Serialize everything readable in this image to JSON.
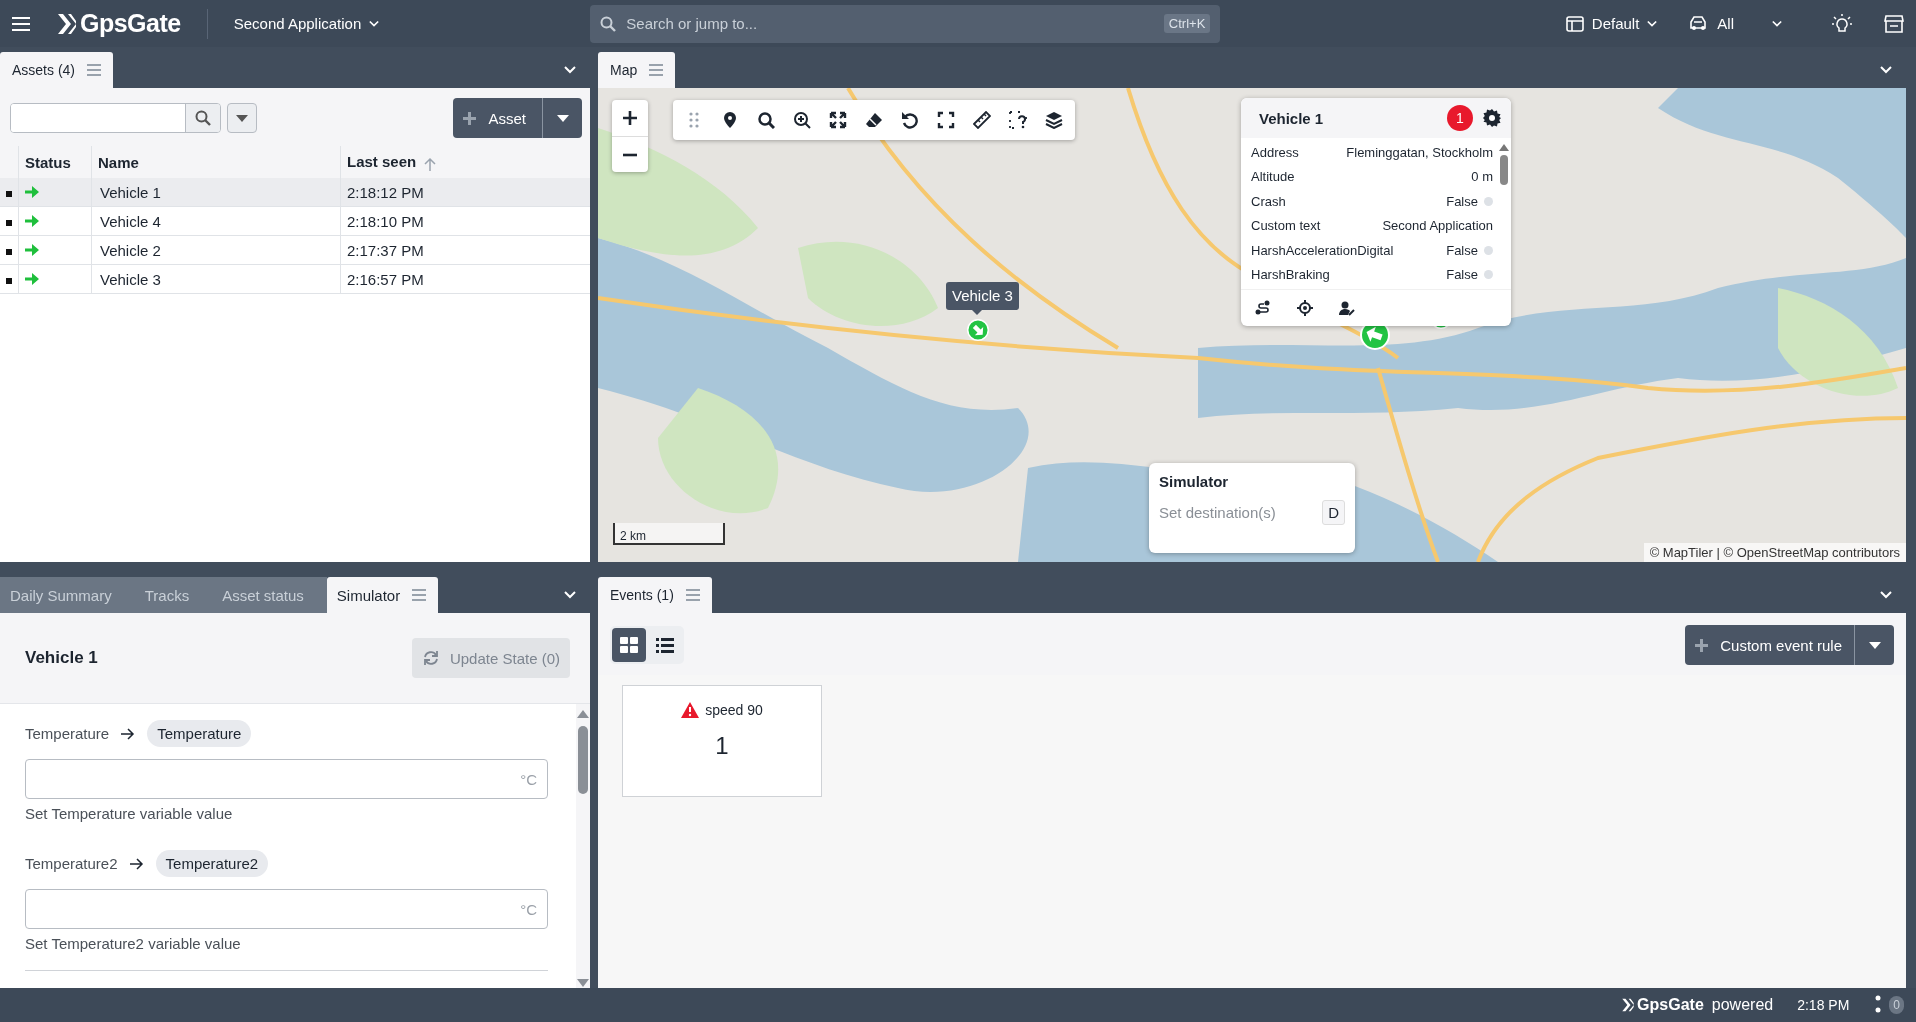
{
  "topbar": {
    "logo": "GpsGate",
    "app_selector": "Second Application",
    "search": {
      "placeholder": "Search or jump to...",
      "shortcut": "Ctrl+K"
    },
    "layout": "Default",
    "filter": "All"
  },
  "assets_panel": {
    "tab": "Assets (4)",
    "add_button": "Asset",
    "columns": [
      "Status",
      "Name",
      "Last seen"
    ],
    "rows": [
      {
        "name": "Vehicle 1",
        "last_seen": "2:18:12 PM",
        "selected": true
      },
      {
        "name": "Vehicle 4",
        "last_seen": "2:18:10 PM",
        "selected": false
      },
      {
        "name": "Vehicle 2",
        "last_seen": "2:17:37 PM",
        "selected": false
      },
      {
        "name": "Vehicle 3",
        "last_seen": "2:16:57 PM",
        "selected": false
      }
    ]
  },
  "map_panel": {
    "tab": "Map",
    "marker_label": "Vehicle 3",
    "scale": "2 km",
    "attribution": "© MapTiler | © OpenStreetMap contributors",
    "popup": {
      "title": "Vehicle 1",
      "badge": "1",
      "properties": [
        {
          "name": "Address",
          "value": "Fleminggatan, Stockholm",
          "kind": "text"
        },
        {
          "name": "Altitude",
          "value": "0 m",
          "kind": "text"
        },
        {
          "name": "Crash",
          "value": "False",
          "kind": "flag"
        },
        {
          "name": "Custom text",
          "value": "Second Application",
          "kind": "text"
        },
        {
          "name": "HarshAccelerationDigital",
          "value": "False",
          "kind": "flag"
        },
        {
          "name": "HarshBraking",
          "value": "False",
          "kind": "flag"
        }
      ]
    },
    "simulator": {
      "title": "Simulator",
      "action": "Set destination(s)",
      "key": "D"
    }
  },
  "simulator_panel": {
    "tabs": [
      {
        "label": "Daily Summary",
        "selected": false
      },
      {
        "label": "Tracks",
        "selected": false
      },
      {
        "label": "Asset status",
        "selected": false
      },
      {
        "label": "Simulator",
        "selected": true
      }
    ],
    "title": "Vehicle 1",
    "update_button": {
      "label": "Update State (0)",
      "disabled": true
    },
    "variables": [
      {
        "name": "Temperature",
        "tag": "Temperature",
        "unit": "°C",
        "help": "Set Temperature variable value"
      },
      {
        "name": "Temperature2",
        "tag": "Temperature2",
        "unit": "°C",
        "help": "Set Temperature2 variable value"
      }
    ]
  },
  "events_panel": {
    "tab": "Events (1)",
    "views": [
      {
        "kind": "grid",
        "selected": true
      },
      {
        "kind": "list",
        "selected": false
      }
    ],
    "add_button": "Custom event rule",
    "cards": [
      {
        "title": "speed 90",
        "count": "1"
      }
    ]
  },
  "status_bar": {
    "brand": "GpsGate",
    "suffix": "powered",
    "time": "2:18 PM",
    "badge": "0"
  }
}
